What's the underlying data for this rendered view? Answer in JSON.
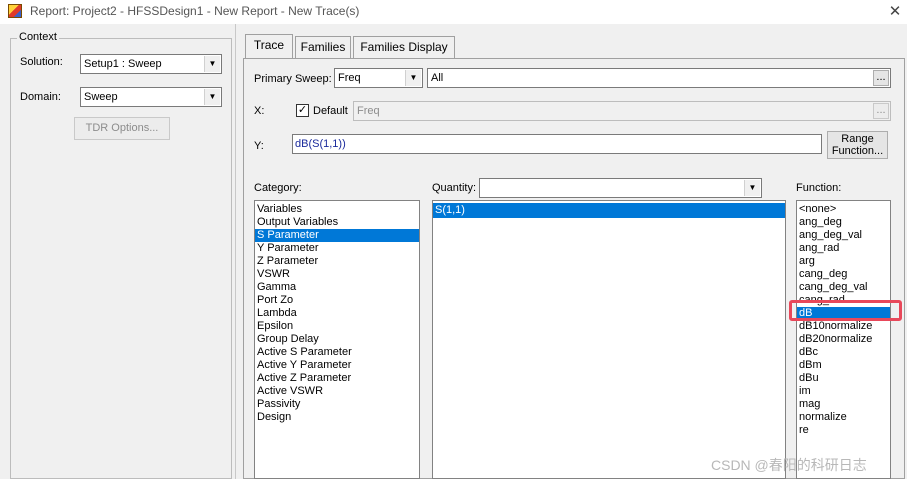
{
  "window": {
    "title": "Report: Project2 - HFSSDesign1 - New Report - New Trace(s)",
    "close_glyph": "✕"
  },
  "context": {
    "legend": "Context",
    "solution_label": "Solution:",
    "solution_value": "Setup1 : Sweep",
    "domain_label": "Domain:",
    "domain_value": "Sweep",
    "tdr_button": "TDR Options..."
  },
  "tabs": [
    {
      "label": "Trace"
    },
    {
      "label": "Families"
    },
    {
      "label": "Families Display"
    }
  ],
  "trace": {
    "primary_sweep_label": "Primary Sweep:",
    "primary_sweep_value": "Freq",
    "primary_sweep_range": "All",
    "ellipsis": "...",
    "x_label": "X:",
    "default_label": "Default",
    "default_checked": true,
    "x_value": "Freq",
    "y_label": "Y:",
    "y_value": "dB(S(1,1))",
    "range_function_line1": "Range",
    "range_function_line2": "Function..."
  },
  "category": {
    "label": "Category:",
    "selected_index": 2,
    "items": [
      "Variables",
      "Output Variables",
      "S Parameter",
      "Y Parameter",
      "Z Parameter",
      "VSWR",
      "Gamma",
      "Port Zo",
      "Lambda",
      "Epsilon",
      "Group Delay",
      "Active S Parameter",
      "Active Y Parameter",
      "Active Z Parameter",
      "Active VSWR",
      "Passivity",
      "Design"
    ]
  },
  "quantity": {
    "label": "Quantity:",
    "filter_value": "",
    "selected_index": 0,
    "items": [
      "S(1,1)"
    ]
  },
  "function": {
    "label": "Function:",
    "selected_index": 8,
    "items": [
      "<none>",
      "ang_deg",
      "ang_deg_val",
      "ang_rad",
      "arg",
      "cang_deg",
      "cang_deg_val",
      "cang_rad",
      "dB",
      "dB10normalize",
      "dB20normalize",
      "dBc",
      "dBm",
      "dBu",
      "im",
      "mag",
      "normalize",
      "re"
    ]
  },
  "watermark": "CSDN @春阳的科研日志",
  "colors": {
    "selection": "#0078d7",
    "highlight": "#e8485a"
  },
  "icons": {
    "dropdown": "chevron-down-icon",
    "app": "hfss-app-icon"
  }
}
